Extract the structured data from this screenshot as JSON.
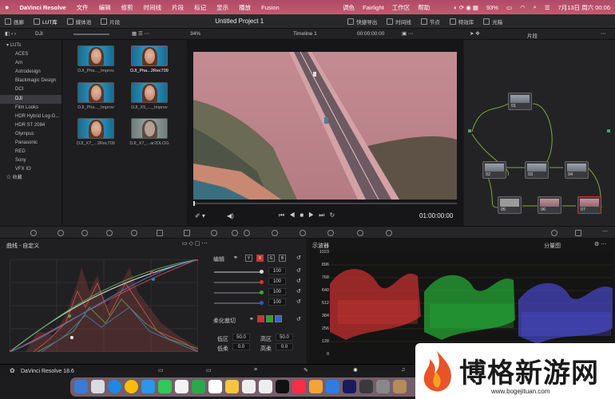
{
  "menubar": {
    "apple": "",
    "app_name": "DaVinci Resolve",
    "items": [
      "文件",
      "编辑",
      "修剪",
      "时间线",
      "片段",
      "标记",
      "显示",
      "播放",
      "Fusion",
      "调色",
      "Fairlight",
      "工作区",
      "帮助"
    ],
    "battery": "93%",
    "datetime": "7月13日 周六 00:06"
  },
  "toolbar": {
    "media_pool": "画廊",
    "lut_lib": "LUT库",
    "media_bin": "媒体池",
    "clips": "片段",
    "project_title": "Untitled Project 1",
    "quick_export": "快捷导出",
    "timeline": "时间线",
    "nodes": "节点",
    "effects": "特效库",
    "lightbox": "光箱"
  },
  "subbar": {
    "folder": "DJI",
    "zoom": "34%",
    "timeline_name": "Timeline 1",
    "timecode": "00:00:00:00",
    "clip_mode": "片段"
  },
  "lut_tree": {
    "root": "LUTs",
    "items": [
      "ACES",
      "Arri",
      "Astrodesign",
      "Blackmagic Design",
      "DCI",
      "DJI",
      "Film Looks",
      "HDR Hybrid Log-G...",
      "HDR ST 2084",
      "Olympus",
      "Panasonic",
      "RED",
      "Sony",
      "VFX IO"
    ],
    "selected": "DJI",
    "favorites": "收藏"
  },
  "luts": [
    {
      "label": "DJI_Pha..._Improv",
      "selected": false
    },
    {
      "label": "DJI_Pha...2Rec709",
      "selected": true
    },
    {
      "label": "DJI_Pha..._Improv",
      "selected": false
    },
    {
      "label": "DJI_X5_..._Improv",
      "selected": false
    },
    {
      "label": "DJI_X7_...2Rec709",
      "selected": false
    },
    {
      "label": "DJI_X7_...ar2DLOG",
      "selected": false
    }
  ],
  "viewer": {
    "timecode": "01:00:00:00"
  },
  "nodes": [
    {
      "label": "01"
    },
    {
      "label": "02"
    },
    {
      "label": "03"
    },
    {
      "label": "04"
    },
    {
      "label": "05"
    },
    {
      "label": "06"
    },
    {
      "label": "07"
    }
  ],
  "curves": {
    "title": "曲线 - 自定义",
    "edit": "编辑",
    "channels": [
      "Y",
      "R",
      "G",
      "B"
    ],
    "values": [
      "100",
      "100",
      "100",
      "100"
    ],
    "soft_clip": "柔化裁切",
    "low": "低区",
    "low_val": "50.0",
    "high": "高区",
    "high_val": "50.0",
    "low_soft": "低柔",
    "low_soft_val": "0.0",
    "high_soft": "高柔",
    "high_soft_val": "0.0"
  },
  "scope": {
    "title": "示波器",
    "mode": "分量图",
    "ticks": [
      "1023",
      "896",
      "768",
      "640",
      "512",
      "384",
      "256",
      "128",
      "0"
    ]
  },
  "bottombar": {
    "brand": "DaVinci Resolve 18.6"
  },
  "watermark": {
    "title": "博格新游网",
    "url": "www.bogejituan.com"
  },
  "colors": {
    "menubar": "#b04a66",
    "accent_red": "#c3384a"
  }
}
